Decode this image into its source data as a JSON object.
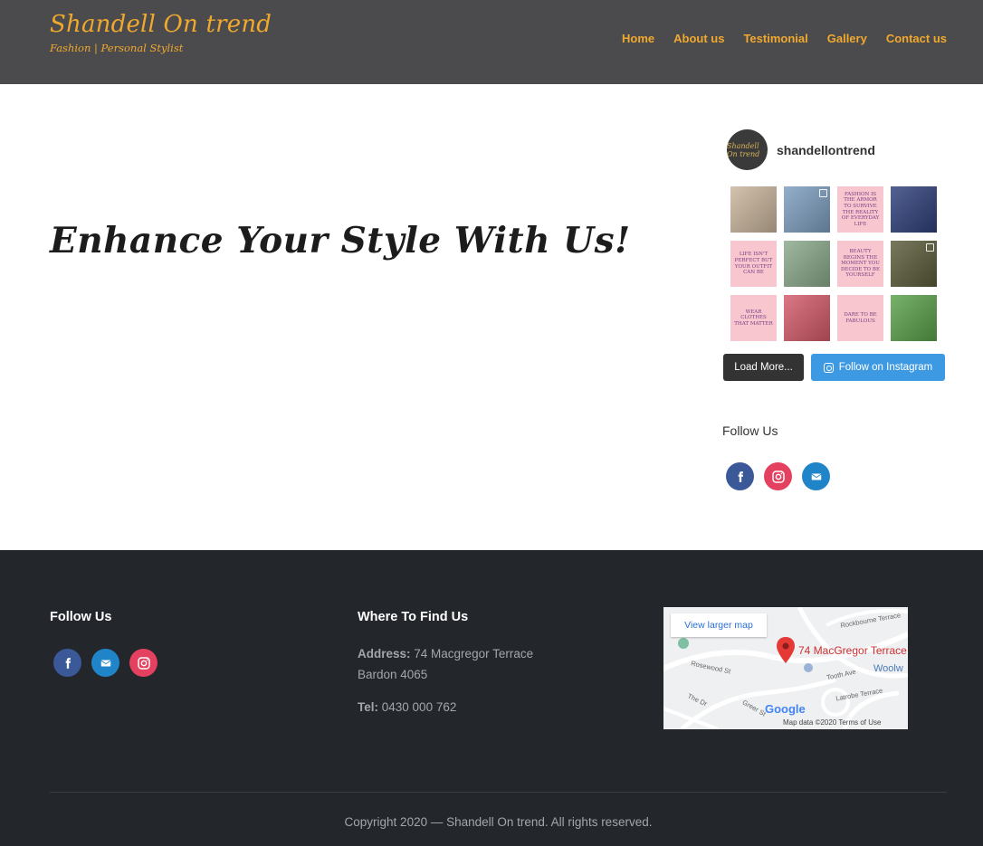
{
  "header": {
    "brand_title": "Shandell On trend",
    "brand_subtitle": "Fashion | Personal Stylist",
    "nav": [
      "Home",
      "About us",
      "Testimonial",
      "Gallery",
      "Contact us"
    ]
  },
  "hero": {
    "title": "Enhance Your Style With Us!"
  },
  "instagram": {
    "username": "shandellontrend",
    "avatar_text": "Shandell On trend",
    "tiles": [
      {
        "kind": "photo",
        "color": "#c9b59c",
        "text": ""
      },
      {
        "kind": "photo",
        "color": "#7d9ec0",
        "text": ""
      },
      {
        "kind": "quote",
        "color": "#f7c6cf",
        "text": "Fashion is the armor to survive the reality of everyday life"
      },
      {
        "kind": "photo",
        "color": "#2e3f7a",
        "text": ""
      },
      {
        "kind": "quote",
        "color": "#f7c6cf",
        "text": "Life isn't perfect but your outfit can be"
      },
      {
        "kind": "photo",
        "color": "#8aa98a",
        "text": ""
      },
      {
        "kind": "quote",
        "color": "#f7c6cf",
        "text": "Beauty begins the moment you decide to be yourself"
      },
      {
        "kind": "photo",
        "color": "#5b5b3a",
        "text": ""
      },
      {
        "kind": "quote",
        "color": "#f7c6cf",
        "text": "Wear clothes that matter"
      },
      {
        "kind": "photo",
        "color": "#d45a6a",
        "text": ""
      },
      {
        "kind": "quote",
        "color": "#f7c6cf",
        "text": "Dare to be fabulous"
      },
      {
        "kind": "photo",
        "color": "#5aa14a",
        "text": ""
      }
    ],
    "load_more_label": "Load More...",
    "follow_label": "Follow on Instagram"
  },
  "sidebar": {
    "follow_title": "Follow Us"
  },
  "footer": {
    "follow_title": "Follow Us",
    "find_title": "Where To Find Us",
    "address_label": "Address:",
    "address_line1": "74 Macgregor Terrace",
    "address_line2": "Bardon 4065",
    "tel_label": "Tel:",
    "tel_value": "0430 000 762",
    "map": {
      "view_larger": "View larger map",
      "pin_label": "74 MacGregor Terrace",
      "google": "Google",
      "legal": "Map data ©2020  Terms of Use",
      "streets": [
        "Rockbourne Terrace",
        "Rosewood St",
        "Tooth Ave",
        "Latrobe Terrace",
        "Greer St",
        "The Dr",
        "Woolw"
      ]
    },
    "copyright": "Copyright 2020 — Shandell On trend. All rights reserved."
  },
  "colors": {
    "accent": "#f0a92d",
    "header_bg": "#4b4b4e",
    "footer_bg": "#23262b",
    "instagram_blue": "#3d9ae2"
  }
}
